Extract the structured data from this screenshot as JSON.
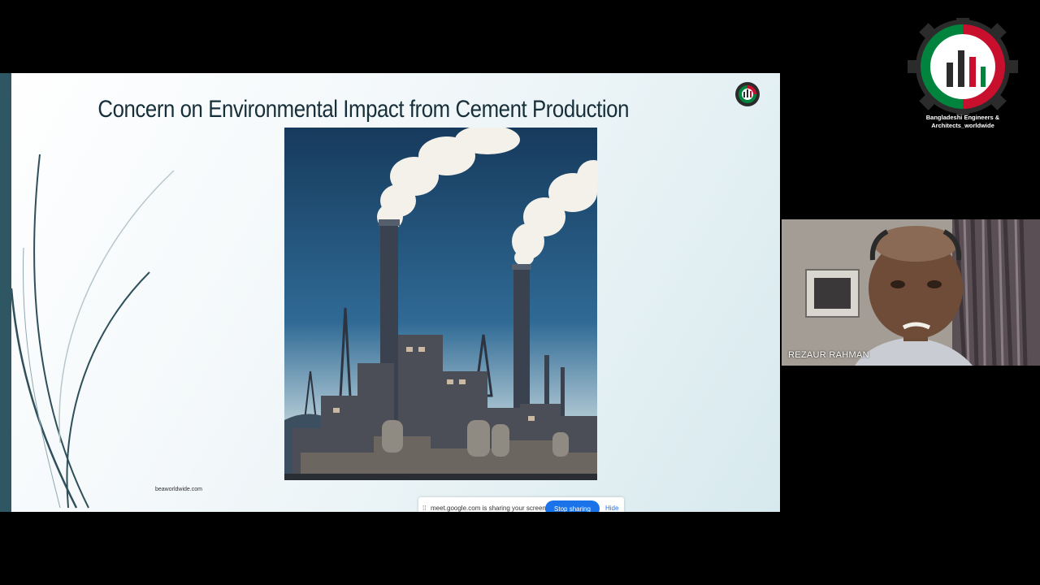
{
  "slide": {
    "title": "Concern on Environmental Impact from Cement Production",
    "footer_url": "beaworldwide.com",
    "image_subject": "cement factory with smokestacks"
  },
  "share_bar": {
    "grip_icon": "drag-handle-icon",
    "message": "meet.google.com is sharing your screen.",
    "stop_label": "Stop sharing",
    "hide_label": "Hide",
    "accent": "#1a73e8"
  },
  "brand": {
    "caption_line1": "Bangladeshi Engineers &",
    "caption_line2": "Architects_worldwide",
    "colors": [
      "#c8102e",
      "#00843d",
      "#2b2b2b",
      "#ffffff"
    ]
  },
  "participant": {
    "name": "REZAUR RAHMAN"
  }
}
